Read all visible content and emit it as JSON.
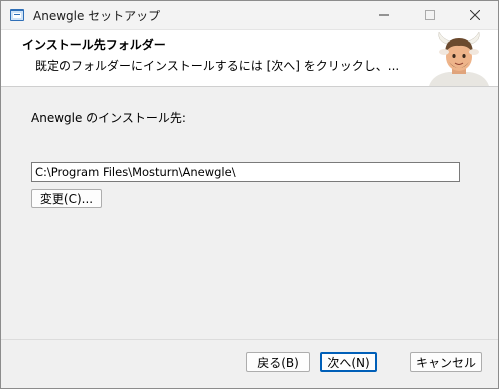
{
  "window": {
    "title": "Anewgle セットアップ",
    "icon": "installer-icon",
    "controls": [
      "minimize-icon",
      "maximize-icon",
      "close-icon"
    ]
  },
  "banner": {
    "title": "インストール先フォルダー",
    "description": "既定のフォルダーにインストールするには [次へ] をクリックし、..."
  },
  "main": {
    "install_to_label": "Anewgle のインストール先:",
    "path_value": "C:\\Program Files\\Mosturn\\Anewgle\\",
    "change_button": "変更(C)..."
  },
  "footer": {
    "back_button": "戻る(B)",
    "next_button": "次へ(N)",
    "cancel_button": "キャンセル"
  }
}
